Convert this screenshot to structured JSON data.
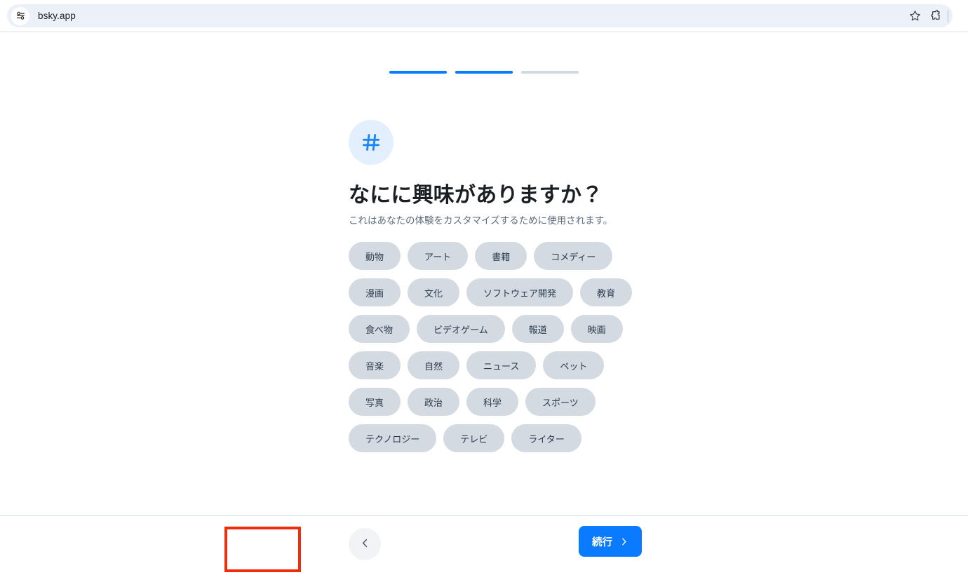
{
  "browser": {
    "url": "bsky.app",
    "site_info_icon": "site-settings-tune-icon",
    "bookmark_icon": "star-icon",
    "extensions_icon": "puzzle-piece-icon"
  },
  "onboarding": {
    "steps": {
      "total": 3,
      "completed": 2,
      "bars": [
        {
          "state": "active"
        },
        {
          "state": "active"
        },
        {
          "state": "inactive"
        }
      ]
    },
    "header_icon": "hashtag-icon",
    "title": "なにに興味がありますか？",
    "subtitle": "これはあなたの体験をカスタマイズするために使用されます。",
    "interests": [
      {
        "label": "動物",
        "selected": false
      },
      {
        "label": "アート",
        "selected": false
      },
      {
        "label": "書籍",
        "selected": false
      },
      {
        "label": "コメディー",
        "selected": false
      },
      {
        "label": "漫画",
        "selected": false
      },
      {
        "label": "文化",
        "selected": false
      },
      {
        "label": "ソフトウェア開発",
        "selected": false
      },
      {
        "label": "教育",
        "selected": false
      },
      {
        "label": "食べ物",
        "selected": false
      },
      {
        "label": "ビデオゲーム",
        "selected": false
      },
      {
        "label": "報道",
        "selected": false
      },
      {
        "label": "映画",
        "selected": false
      },
      {
        "label": "音楽",
        "selected": false
      },
      {
        "label": "自然",
        "selected": false
      },
      {
        "label": "ニュース",
        "selected": false
      },
      {
        "label": "ペット",
        "selected": false
      },
      {
        "label": "写真",
        "selected": false
      },
      {
        "label": "政治",
        "selected": false
      },
      {
        "label": "科学",
        "selected": false
      },
      {
        "label": "スポーツ",
        "selected": false
      },
      {
        "label": "テクノロジー",
        "selected": false
      },
      {
        "label": "テレビ",
        "selected": false
      },
      {
        "label": "ライター",
        "selected": false
      }
    ],
    "footer": {
      "back_icon": "chevron-left-icon",
      "continue_label": "続行",
      "continue_icon": "chevron-right-icon",
      "highlighted": true
    }
  },
  "colors": {
    "accent_blue": "#0a7aff",
    "icon_circle_bg": "#e3effd",
    "chip_bg": "#d3dae2",
    "chip_text": "#2c3c4e",
    "highlight_red": "#f22d0c",
    "omnibox_bg": "#ecf0f8",
    "step_inactive": "#d4d9e0"
  }
}
